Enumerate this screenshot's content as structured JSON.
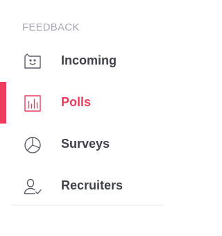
{
  "section": {
    "header": "FEEDBACK"
  },
  "nav": {
    "items": [
      {
        "label": "Incoming",
        "icon": "inbox-tray-icon",
        "active": false
      },
      {
        "label": "Polls",
        "icon": "bar-chart-icon",
        "active": true
      },
      {
        "label": "Surveys",
        "icon": "pie-chart-icon",
        "active": false
      },
      {
        "label": "Recruiters",
        "icon": "user-check-icon",
        "active": false
      }
    ]
  },
  "colors": {
    "accent": "#ef3b5d",
    "text": "#3f4349",
    "icon": "#5b6068",
    "header": "#a4a9b0",
    "divider": "#e3e5e8"
  }
}
